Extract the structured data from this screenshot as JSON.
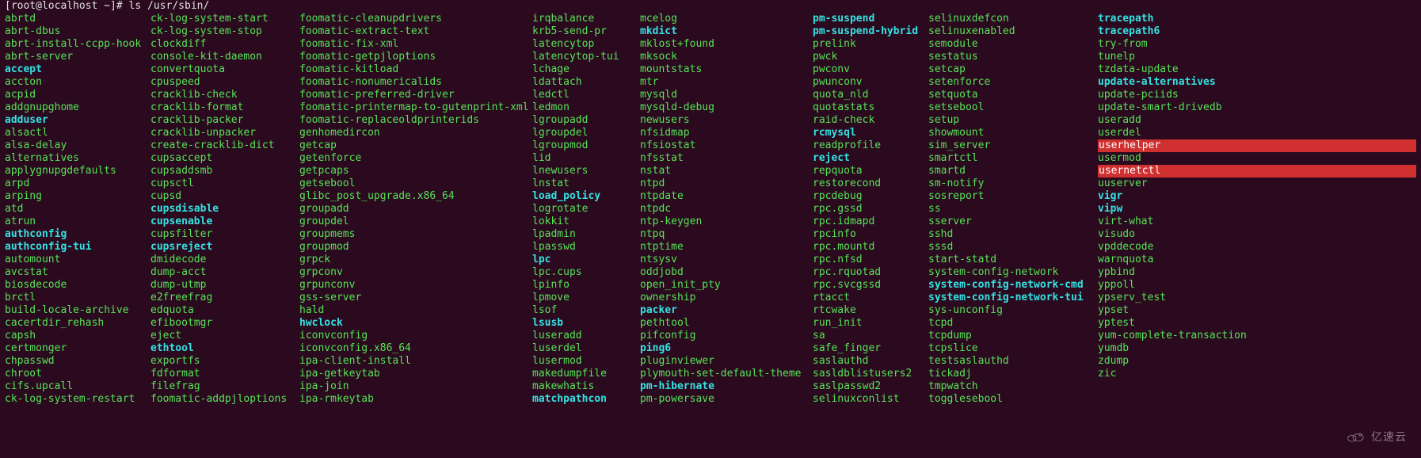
{
  "prompt_user": "[root@localhost ~]# ",
  "prompt_cmd": "ls /usr/sbin/",
  "watermark": "亿速云",
  "columns": [
    [
      {
        "t": "abrtd",
        "c": "g"
      },
      {
        "t": "abrt-dbus",
        "c": "g"
      },
      {
        "t": "abrt-install-ccpp-hook",
        "c": "g"
      },
      {
        "t": "abrt-server",
        "c": "g"
      },
      {
        "t": "accept",
        "c": "c"
      },
      {
        "t": "accton",
        "c": "g"
      },
      {
        "t": "acpid",
        "c": "g"
      },
      {
        "t": "addgnupghome",
        "c": "g"
      },
      {
        "t": "adduser",
        "c": "c"
      },
      {
        "t": "alsactl",
        "c": "g"
      },
      {
        "t": "alsa-delay",
        "c": "g"
      },
      {
        "t": "alternatives",
        "c": "g"
      },
      {
        "t": "applygnupgdefaults",
        "c": "g"
      },
      {
        "t": "arpd",
        "c": "g"
      },
      {
        "t": "arping",
        "c": "g"
      },
      {
        "t": "atd",
        "c": "g"
      },
      {
        "t": "atrun",
        "c": "g"
      },
      {
        "t": "authconfig",
        "c": "c"
      },
      {
        "t": "authconfig-tui",
        "c": "c"
      },
      {
        "t": "automount",
        "c": "g"
      },
      {
        "t": "avcstat",
        "c": "g"
      },
      {
        "t": "biosdecode",
        "c": "g"
      },
      {
        "t": "brctl",
        "c": "g"
      },
      {
        "t": "build-locale-archive",
        "c": "g"
      },
      {
        "t": "cacertdir_rehash",
        "c": "g"
      },
      {
        "t": "capsh",
        "c": "g"
      },
      {
        "t": "certmonger",
        "c": "g"
      },
      {
        "t": "chpasswd",
        "c": "g"
      },
      {
        "t": "chroot",
        "c": "g"
      },
      {
        "t": "cifs.upcall",
        "c": "g"
      },
      {
        "t": "ck-log-system-restart",
        "c": "g"
      }
    ],
    [
      {
        "t": "ck-log-system-start",
        "c": "g"
      },
      {
        "t": "ck-log-system-stop",
        "c": "g"
      },
      {
        "t": "clockdiff",
        "c": "g"
      },
      {
        "t": "console-kit-daemon",
        "c": "g"
      },
      {
        "t": "convertquota",
        "c": "g"
      },
      {
        "t": "cpuspeed",
        "c": "g"
      },
      {
        "t": "cracklib-check",
        "c": "g"
      },
      {
        "t": "cracklib-format",
        "c": "g"
      },
      {
        "t": "cracklib-packer",
        "c": "g"
      },
      {
        "t": "cracklib-unpacker",
        "c": "g"
      },
      {
        "t": "create-cracklib-dict",
        "c": "g"
      },
      {
        "t": "cupsaccept",
        "c": "g"
      },
      {
        "t": "cupsaddsmb",
        "c": "g"
      },
      {
        "t": "cupsctl",
        "c": "g"
      },
      {
        "t": "cupsd",
        "c": "g"
      },
      {
        "t": "cupsdisable",
        "c": "c"
      },
      {
        "t": "cupsenable",
        "c": "c"
      },
      {
        "t": "cupsfilter",
        "c": "g"
      },
      {
        "t": "cupsreject",
        "c": "c"
      },
      {
        "t": "dmidecode",
        "c": "g"
      },
      {
        "t": "dump-acct",
        "c": "g"
      },
      {
        "t": "dump-utmp",
        "c": "g"
      },
      {
        "t": "e2freefrag",
        "c": "g"
      },
      {
        "t": "edquota",
        "c": "g"
      },
      {
        "t": "efibootmgr",
        "c": "g"
      },
      {
        "t": "eject",
        "c": "g"
      },
      {
        "t": "ethtool",
        "c": "c"
      },
      {
        "t": "exportfs",
        "c": "g"
      },
      {
        "t": "fdformat",
        "c": "g"
      },
      {
        "t": "filefrag",
        "c": "g"
      },
      {
        "t": "foomatic-addpjloptions",
        "c": "g"
      }
    ],
    [
      {
        "t": "foomatic-cleanupdrivers",
        "c": "g"
      },
      {
        "t": "foomatic-extract-text",
        "c": "g"
      },
      {
        "t": "foomatic-fix-xml",
        "c": "g"
      },
      {
        "t": "foomatic-getpjloptions",
        "c": "g"
      },
      {
        "t": "foomatic-kitload",
        "c": "g"
      },
      {
        "t": "foomatic-nonumericalids",
        "c": "g"
      },
      {
        "t": "foomatic-preferred-driver",
        "c": "g"
      },
      {
        "t": "foomatic-printermap-to-gutenprint-xml",
        "c": "g"
      },
      {
        "t": "foomatic-replaceoldprinterids",
        "c": "g"
      },
      {
        "t": "genhomedircon",
        "c": "g"
      },
      {
        "t": "getcap",
        "c": "g"
      },
      {
        "t": "getenforce",
        "c": "g"
      },
      {
        "t": "getpcaps",
        "c": "g"
      },
      {
        "t": "getsebool",
        "c": "g"
      },
      {
        "t": "glibc_post_upgrade.x86_64",
        "c": "g"
      },
      {
        "t": "groupadd",
        "c": "g"
      },
      {
        "t": "groupdel",
        "c": "g"
      },
      {
        "t": "groupmems",
        "c": "g"
      },
      {
        "t": "groupmod",
        "c": "g"
      },
      {
        "t": "grpck",
        "c": "g"
      },
      {
        "t": "grpconv",
        "c": "g"
      },
      {
        "t": "grpunconv",
        "c": "g"
      },
      {
        "t": "gss-server",
        "c": "g"
      },
      {
        "t": "hald",
        "c": "g"
      },
      {
        "t": "hwclock",
        "c": "c"
      },
      {
        "t": "iconvconfig",
        "c": "g"
      },
      {
        "t": "iconvconfig.x86_64",
        "c": "g"
      },
      {
        "t": "ipa-client-install",
        "c": "g"
      },
      {
        "t": "ipa-getkeytab",
        "c": "g"
      },
      {
        "t": "ipa-join",
        "c": "g"
      },
      {
        "t": "ipa-rmkeytab",
        "c": "g"
      }
    ],
    [
      {
        "t": "irqbalance",
        "c": "g"
      },
      {
        "t": "krb5-send-pr",
        "c": "g"
      },
      {
        "t": "latencytop",
        "c": "g"
      },
      {
        "t": "latencytop-tui",
        "c": "g"
      },
      {
        "t": "lchage",
        "c": "g"
      },
      {
        "t": "ldattach",
        "c": "g"
      },
      {
        "t": "ledctl",
        "c": "g"
      },
      {
        "t": "ledmon",
        "c": "g"
      },
      {
        "t": "lgroupadd",
        "c": "g"
      },
      {
        "t": "lgroupdel",
        "c": "g"
      },
      {
        "t": "lgroupmod",
        "c": "g"
      },
      {
        "t": "lid",
        "c": "g"
      },
      {
        "t": "lnewusers",
        "c": "g"
      },
      {
        "t": "lnstat",
        "c": "g"
      },
      {
        "t": "load_policy",
        "c": "c"
      },
      {
        "t": "logrotate",
        "c": "g"
      },
      {
        "t": "lokkit",
        "c": "g"
      },
      {
        "t": "lpadmin",
        "c": "g"
      },
      {
        "t": "lpasswd",
        "c": "g"
      },
      {
        "t": "lpc",
        "c": "c"
      },
      {
        "t": "lpc.cups",
        "c": "g"
      },
      {
        "t": "lpinfo",
        "c": "g"
      },
      {
        "t": "lpmove",
        "c": "g"
      },
      {
        "t": "lsof",
        "c": "g"
      },
      {
        "t": "lsusb",
        "c": "c"
      },
      {
        "t": "luseradd",
        "c": "g"
      },
      {
        "t": "luserdel",
        "c": "g"
      },
      {
        "t": "lusermod",
        "c": "g"
      },
      {
        "t": "makedumpfile",
        "c": "g"
      },
      {
        "t": "makewhatis",
        "c": "g"
      },
      {
        "t": "matchpathcon",
        "c": "c"
      }
    ],
    [
      {
        "t": "mcelog",
        "c": "g"
      },
      {
        "t": "mkdict",
        "c": "c"
      },
      {
        "t": "mklost+found",
        "c": "g"
      },
      {
        "t": "mksock",
        "c": "g"
      },
      {
        "t": "mountstats",
        "c": "g"
      },
      {
        "t": "mtr",
        "c": "g"
      },
      {
        "t": "mysqld",
        "c": "g"
      },
      {
        "t": "mysqld-debug",
        "c": "g"
      },
      {
        "t": "newusers",
        "c": "g"
      },
      {
        "t": "nfsidmap",
        "c": "g"
      },
      {
        "t": "nfsiostat",
        "c": "g"
      },
      {
        "t": "nfsstat",
        "c": "g"
      },
      {
        "t": "nstat",
        "c": "g"
      },
      {
        "t": "ntpd",
        "c": "g"
      },
      {
        "t": "ntpdate",
        "c": "g"
      },
      {
        "t": "ntpdc",
        "c": "g"
      },
      {
        "t": "ntp-keygen",
        "c": "g"
      },
      {
        "t": "ntpq",
        "c": "g"
      },
      {
        "t": "ntptime",
        "c": "g"
      },
      {
        "t": "ntsysv",
        "c": "g"
      },
      {
        "t": "oddjobd",
        "c": "g"
      },
      {
        "t": "open_init_pty",
        "c": "g"
      },
      {
        "t": "ownership",
        "c": "g"
      },
      {
        "t": "packer",
        "c": "c"
      },
      {
        "t": "pethtool",
        "c": "g"
      },
      {
        "t": "pifconfig",
        "c": "g"
      },
      {
        "t": "ping6",
        "c": "c"
      },
      {
        "t": "pluginviewer",
        "c": "g"
      },
      {
        "t": "plymouth-set-default-theme",
        "c": "g"
      },
      {
        "t": "pm-hibernate",
        "c": "c"
      },
      {
        "t": "pm-powersave",
        "c": "g"
      }
    ],
    [
      {
        "t": "pm-suspend",
        "c": "c"
      },
      {
        "t": "pm-suspend-hybrid",
        "c": "c"
      },
      {
        "t": "prelink",
        "c": "g"
      },
      {
        "t": "pwck",
        "c": "g"
      },
      {
        "t": "pwconv",
        "c": "g"
      },
      {
        "t": "pwunconv",
        "c": "g"
      },
      {
        "t": "quota_nld",
        "c": "g"
      },
      {
        "t": "quotastats",
        "c": "g"
      },
      {
        "t": "raid-check",
        "c": "g"
      },
      {
        "t": "rcmysql",
        "c": "c"
      },
      {
        "t": "readprofile",
        "c": "g"
      },
      {
        "t": "reject",
        "c": "c"
      },
      {
        "t": "repquota",
        "c": "g"
      },
      {
        "t": "restorecond",
        "c": "g"
      },
      {
        "t": "rpcdebug",
        "c": "g"
      },
      {
        "t": "rpc.gssd",
        "c": "g"
      },
      {
        "t": "rpc.idmapd",
        "c": "g"
      },
      {
        "t": "rpcinfo",
        "c": "g"
      },
      {
        "t": "rpc.mountd",
        "c": "g"
      },
      {
        "t": "rpc.nfsd",
        "c": "g"
      },
      {
        "t": "rpc.rquotad",
        "c": "g"
      },
      {
        "t": "rpc.svcgssd",
        "c": "g"
      },
      {
        "t": "rtacct",
        "c": "g"
      },
      {
        "t": "rtcwake",
        "c": "g"
      },
      {
        "t": "run_init",
        "c": "g"
      },
      {
        "t": "sa",
        "c": "g"
      },
      {
        "t": "safe_finger",
        "c": "g"
      },
      {
        "t": "saslauthd",
        "c": "g"
      },
      {
        "t": "sasldblistusers2",
        "c": "g"
      },
      {
        "t": "saslpasswd2",
        "c": "g"
      },
      {
        "t": "selinuxconlist",
        "c": "g"
      }
    ],
    [
      {
        "t": "selinuxdefcon",
        "c": "g"
      },
      {
        "t": "selinuxenabled",
        "c": "g"
      },
      {
        "t": "semodule",
        "c": "g"
      },
      {
        "t": "sestatus",
        "c": "g"
      },
      {
        "t": "setcap",
        "c": "g"
      },
      {
        "t": "setenforce",
        "c": "g"
      },
      {
        "t": "setquota",
        "c": "g"
      },
      {
        "t": "setsebool",
        "c": "g"
      },
      {
        "t": "setup",
        "c": "g"
      },
      {
        "t": "showmount",
        "c": "g"
      },
      {
        "t": "sim_server",
        "c": "g"
      },
      {
        "t": "smartctl",
        "c": "g"
      },
      {
        "t": "smartd",
        "c": "g"
      },
      {
        "t": "sm-notify",
        "c": "g"
      },
      {
        "t": "sosreport",
        "c": "g"
      },
      {
        "t": "ss",
        "c": "g"
      },
      {
        "t": "sserver",
        "c": "g"
      },
      {
        "t": "sshd",
        "c": "g"
      },
      {
        "t": "sssd",
        "c": "g"
      },
      {
        "t": "start-statd",
        "c": "g"
      },
      {
        "t": "system-config-network",
        "c": "g"
      },
      {
        "t": "system-config-network-cmd",
        "c": "c"
      },
      {
        "t": "system-config-network-tui",
        "c": "c"
      },
      {
        "t": "sys-unconfig",
        "c": "g"
      },
      {
        "t": "tcpd",
        "c": "g"
      },
      {
        "t": "tcpdump",
        "c": "g"
      },
      {
        "t": "tcpslice",
        "c": "g"
      },
      {
        "t": "testsaslauthd",
        "c": "g"
      },
      {
        "t": "tickadj",
        "c": "g"
      },
      {
        "t": "tmpwatch",
        "c": "g"
      },
      {
        "t": "togglesebool",
        "c": "g"
      }
    ],
    [
      {
        "t": "tracepath",
        "c": "c"
      },
      {
        "t": "tracepath6",
        "c": "c"
      },
      {
        "t": "try-from",
        "c": "g"
      },
      {
        "t": "tunelp",
        "c": "g"
      },
      {
        "t": "tzdata-update",
        "c": "g"
      },
      {
        "t": "update-alternatives",
        "c": "c"
      },
      {
        "t": "update-pciids",
        "c": "g"
      },
      {
        "t": "update-smart-drivedb",
        "c": "g"
      },
      {
        "t": "useradd",
        "c": "g"
      },
      {
        "t": "userdel",
        "c": "g"
      },
      {
        "t": "userhelper",
        "c": "hl"
      },
      {
        "t": "usermod",
        "c": "g"
      },
      {
        "t": "usernetctl",
        "c": "hl"
      },
      {
        "t": "uuserver",
        "c": "g"
      },
      {
        "t": "vigr",
        "c": "c"
      },
      {
        "t": "vipw",
        "c": "c"
      },
      {
        "t": "virt-what",
        "c": "g"
      },
      {
        "t": "visudo",
        "c": "g"
      },
      {
        "t": "vpddecode",
        "c": "g"
      },
      {
        "t": "warnquota",
        "c": "g"
      },
      {
        "t": "ypbind",
        "c": "g"
      },
      {
        "t": "yppoll",
        "c": "g"
      },
      {
        "t": "ypserv_test",
        "c": "g"
      },
      {
        "t": "ypset",
        "c": "g"
      },
      {
        "t": "yptest",
        "c": "g"
      },
      {
        "t": "yum-complete-transaction",
        "c": "g"
      },
      {
        "t": "yumdb",
        "c": "g"
      },
      {
        "t": "zdump",
        "c": "g"
      },
      {
        "t": "zic",
        "c": "g"
      }
    ]
  ]
}
